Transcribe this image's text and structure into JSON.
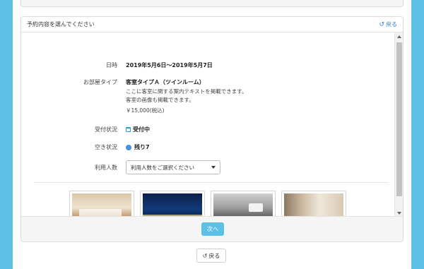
{
  "panel": {
    "title": "予約内容を選んでください",
    "back_label": "戻る"
  },
  "details": {
    "date_label": "日時",
    "date_value": "2019年5月6日～2019年5月7日",
    "room_label": "お部屋タイプ",
    "room_name": "客室タイプＡ（ツインルーム）",
    "room_desc_line1": "ここに客室に関する案内テキストを掲載できます。",
    "room_desc_line2": "客室の画像も掲載できます。",
    "room_price": "￥15,000(税込)",
    "reception_label": "受付状況",
    "reception_value": "受付中",
    "vacancy_label": "空き状況",
    "vacancy_value": "残り7",
    "guests_label": "利用人数",
    "guests_placeholder": "利用人数をご選択ください"
  },
  "footer": {
    "next_label": "次へ"
  },
  "bottom": {
    "back_label": "戻る"
  },
  "colors": {
    "background": "#5bc0e4",
    "accent": "#5bc0e4",
    "link": "#2a7fd4",
    "status_open": "#2a9fd6",
    "vacancy_dot": "#4a90e2"
  },
  "icons": {
    "back": "undo-arrow-icon",
    "calendar": "calendar-icon",
    "dropdown": "caret-down-icon"
  }
}
